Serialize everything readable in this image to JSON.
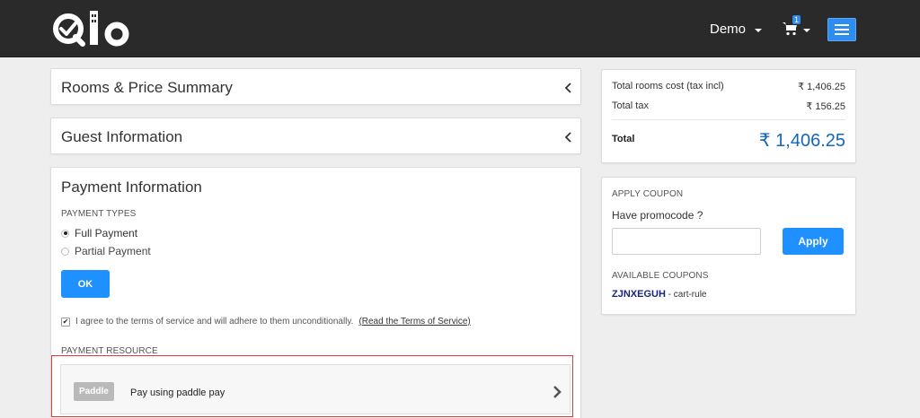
{
  "header": {
    "logo_text": "Qlo",
    "user_menu_label": "Demo",
    "cart_count": "1",
    "cart_icon": "cart-icon",
    "menu_icon": "hamburger-menu-icon",
    "accent_color": "#2d8cf0",
    "bar_color": "#2a2a2a"
  },
  "accordions": {
    "rooms_summary_title": "Rooms & Price Summary",
    "guest_info_title": "Guest Information"
  },
  "payment": {
    "title": "Payment Information",
    "types_label": "PAYMENT TYPES",
    "options": [
      {
        "label": "Full Payment",
        "checked": true
      },
      {
        "label": "Partial Payment",
        "checked": false
      }
    ],
    "ok_button": "OK",
    "terms_text": "I agree to the terms of service and will adhere to them unconditionally.",
    "terms_link": "(Read the Terms of Service)",
    "terms_checked": true,
    "resource_label": "PAYMENT RESOURCE",
    "method": {
      "badge": "Paddle",
      "label": "Pay using paddle pay"
    }
  },
  "summary": {
    "rows": [
      {
        "label": "Total rooms cost (tax incl)",
        "value": "₹ 1,406.25"
      },
      {
        "label": "Total tax",
        "value": "₹ 156.25"
      }
    ],
    "total_label": "Total",
    "total_value": "₹ 1,406.25"
  },
  "coupon": {
    "title": "APPLY COUPON",
    "prompt": "Have promocode ?",
    "input_value": "",
    "input_placeholder": "",
    "apply_button": "Apply",
    "available_label": "AVAILABLE COUPONS",
    "items": [
      {
        "code": "ZJNXEGUH",
        "separator": " - ",
        "rule": "cart-rule"
      }
    ]
  }
}
